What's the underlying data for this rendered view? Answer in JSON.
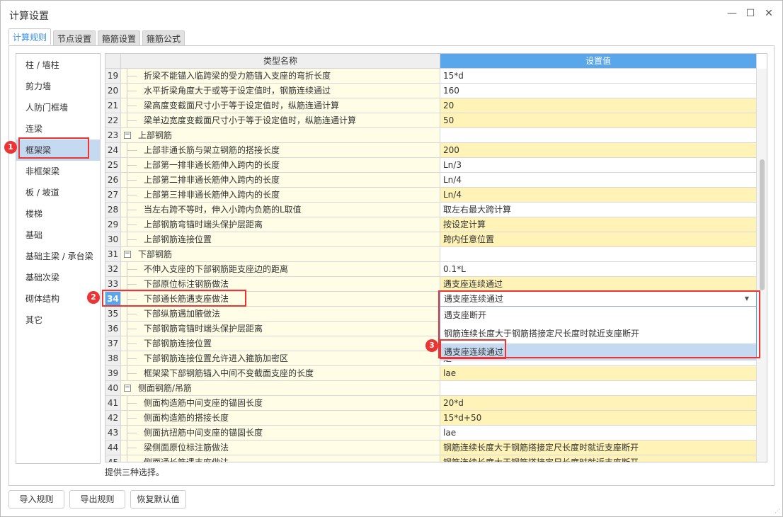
{
  "window": {
    "title": "计算设置"
  },
  "tabs": [
    "计算规则",
    "节点设置",
    "箍筋设置",
    "箍筋公式"
  ],
  "sidebar": [
    "柱 / 墙柱",
    "剪力墙",
    "人防门框墙",
    "连梁",
    "框架梁",
    "非框架梁",
    "板 / 坡道",
    "楼梯",
    "基础",
    "基础主梁 / 承台梁",
    "基础次梁",
    "砌体结构",
    "其它"
  ],
  "sidebar_selected": "框架梁",
  "grid": {
    "headers": {
      "name": "类型名称",
      "value": "设置值"
    },
    "current_row": "34",
    "rows": [
      {
        "n": "19",
        "name": "折梁不能锚入临跨梁的受力筋锚入支座的弯折长度",
        "value": "15*d",
        "hl": false
      },
      {
        "n": "20",
        "name": "水平折梁角度大于或等于设定值时，钢筋连续通过",
        "value": "160",
        "hl": false
      },
      {
        "n": "21",
        "name": "梁高度变截面尺寸小于等于设定值时，纵筋连通计算",
        "value": "20",
        "hl": true
      },
      {
        "n": "22",
        "name": "梁单边宽度变截面尺寸小于等于设定值时，纵筋连通计算",
        "value": "50",
        "hl": true
      },
      {
        "n": "23",
        "name": "上部钢筋",
        "value": "",
        "group": true
      },
      {
        "n": "24",
        "name": "上部非通长筋与架立钢筋的搭接长度",
        "value": "200",
        "hl": true
      },
      {
        "n": "25",
        "name": "上部第一排非通长筋伸入跨内的长度",
        "value": "Ln/3",
        "hl": false
      },
      {
        "n": "26",
        "name": "上部第二排非通长筋伸入跨内的长度",
        "value": "Ln/4",
        "hl": false
      },
      {
        "n": "27",
        "name": "上部第三排非通长筋伸入跨内的长度",
        "value": "Ln/4",
        "hl": true
      },
      {
        "n": "28",
        "name": "当左右跨不等时，伸入小跨内负筋的L取值",
        "value": "取左右最大跨计算",
        "hl": false
      },
      {
        "n": "29",
        "name": "上部钢筋弯锚时端头保护层距离",
        "value": "按设定计算",
        "hl": true
      },
      {
        "n": "30",
        "name": "上部钢筋连接位置",
        "value": "跨内任意位置",
        "hl": true
      },
      {
        "n": "31",
        "name": "下部钢筋",
        "value": "",
        "group": true
      },
      {
        "n": "32",
        "name": "不伸入支座的下部钢筋距支座边的距离",
        "value": "0.1*L",
        "hl": false
      },
      {
        "n": "33",
        "name": "下部原位标注钢筋做法",
        "value": "遇支座连续通过",
        "hl": true
      },
      {
        "n": "34",
        "name": "下部通长筋遇支座做法",
        "value": "",
        "hl": false
      },
      {
        "n": "35",
        "name": "下部纵筋遇加腋做法",
        "value": "",
        "hl": false
      },
      {
        "n": "36",
        "name": "下部钢筋弯锚时端头保护层距离",
        "value": "",
        "hl": false
      },
      {
        "n": "37",
        "name": "下部钢筋连接位置",
        "value": "",
        "hl": false
      },
      {
        "n": "38",
        "name": "下部钢筋连接位置允许进入箍筋加密区",
        "value": "是",
        "hl": false
      },
      {
        "n": "39",
        "name": "框架梁下部钢筋锚入中间不变截面支座的长度",
        "value": "lae",
        "hl": true
      },
      {
        "n": "40",
        "name": "侧面钢筋/吊筋",
        "value": "",
        "group": true
      },
      {
        "n": "41",
        "name": "侧面构造筋中间支座的锚固长度",
        "value": "20*d",
        "hl": true
      },
      {
        "n": "42",
        "name": "侧面构造筋的搭接长度",
        "value": "15*d+50",
        "hl": true
      },
      {
        "n": "43",
        "name": "侧面抗扭筋中间支座的锚固长度",
        "value": "lae",
        "hl": false
      },
      {
        "n": "44",
        "name": "梁侧面原位标注筋做法",
        "value": "钢筋连续长度大于钢筋搭接定尺长度时就近支座断开",
        "hl": true
      },
      {
        "n": "45",
        "name": "侧面通长筋遇支座做法",
        "value": "钢筋连续长度大于钢筋搭接定尺长度时就近支座断开",
        "hl": true
      }
    ]
  },
  "dropdown": {
    "selected": "遇支座连续通过",
    "options": [
      "遇支座断开",
      "钢筋连续长度大于钢筋搭接定尺长度时就近支座断开",
      "遇支座连续通过"
    ],
    "highlighted": 2
  },
  "badges": [
    "1",
    "2",
    "3"
  ],
  "status": "提供三种选择。",
  "buttons": {
    "import": "导入规则",
    "export": "导出规则",
    "reset": "恢复默认值"
  },
  "colors": {
    "accent": "#5aa6ea",
    "highlight": "#fff3b8",
    "annotation": "#e33333"
  }
}
